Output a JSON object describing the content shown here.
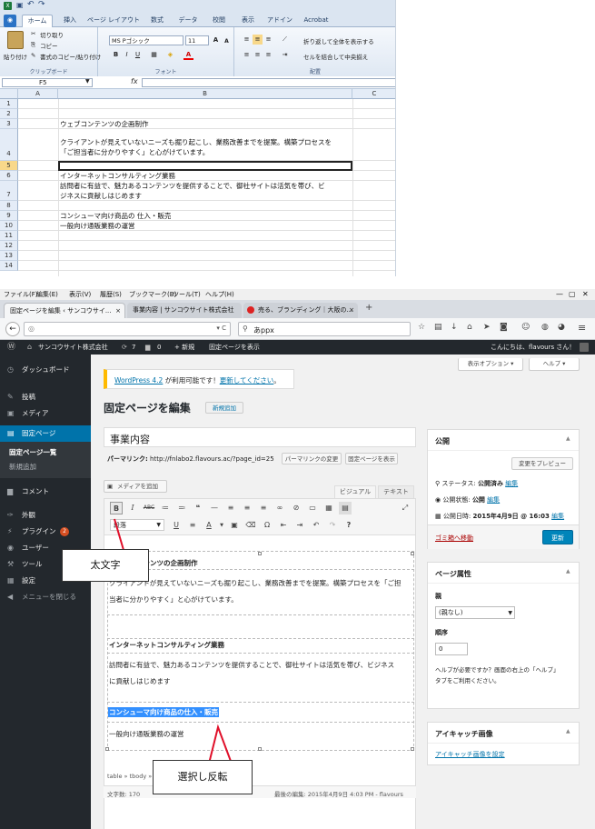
{
  "excel": {
    "tabs": [
      "ホーム",
      "挿入",
      "ページ レイアウト",
      "数式",
      "データ",
      "校閲",
      "表示",
      "アドイン",
      "Acrobat"
    ],
    "clipboard": {
      "paste": "貼り付け",
      "cut": "切り取り",
      "copy": "コピー",
      "format_painter": "書式のコピー/貼り付け",
      "label": "クリップボード"
    },
    "font": {
      "name": "MS Pゴシック",
      "size": "11",
      "label": "フォント"
    },
    "alignment": {
      "wrap": "折り返して全体を表示する",
      "merge": "セルを結合して中央揃え",
      "label": "配置"
    },
    "namebox": "F5",
    "fx": "fx",
    "columns": [
      "A",
      "B",
      "C"
    ],
    "rows": [
      "1",
      "2",
      "3",
      "4",
      "5",
      "6",
      "7",
      "8",
      "9",
      "10",
      "11",
      "12",
      "13",
      "14"
    ],
    "cells": {
      "r3": "ウェブコンテンツの企画制作",
      "r4a": "クライアントが見えていないニーズも掘り起こし、業務改善までを提案。構築プロセスを",
      "r4b": "「ご担当者に分かりやすく」と心がけています。",
      "r6": "インターネットコンサルティング業務",
      "r7a": "訪問者に有益で、魅力あるコンテンツを提供することで、御社サイトは活気を帯び、ビ",
      "r7b": "ジネスに貢献しはじめます",
      "r9": "コンシューマ向け商品の 仕入・販売",
      "r10": "一般向け通販業務の運営"
    }
  },
  "browser": {
    "menu": [
      "ファイル(F)",
      "編集(E)",
      "表示(V)",
      "履歴(S)",
      "ブックマーク(B)",
      "ツール(T)",
      "ヘルプ(H)"
    ],
    "tabs": [
      "固定ページを編集 ‹ サンコウサイ...",
      "事業内容 | サンコウサイト株式会社",
      "売る、ブランディング｜大阪の..."
    ],
    "new_tab": "+",
    "search_value": "あppx"
  },
  "wp": {
    "adminbar": {
      "site": "サンコウサイト株式会社",
      "updates": "7",
      "comments": "0",
      "new": "+ 新規",
      "view": "固定ページを表示",
      "greeting": "こんにちは、flavours さん！"
    },
    "menu": [
      {
        "icon": "ダ",
        "label": "ダッシュボード"
      },
      {
        "icon": "投",
        "label": "投稿"
      },
      {
        "icon": "メ",
        "label": "メディア"
      },
      {
        "icon": "固",
        "label": "固定ページ"
      },
      {
        "icon": "",
        "label": "固定ページ一覧"
      },
      {
        "icon": "",
        "label": "新規追加"
      },
      {
        "icon": "コ",
        "label": "コメント"
      },
      {
        "icon": "外",
        "label": "外観"
      },
      {
        "icon": "プ",
        "label": "プラグイン"
      },
      {
        "icon": "ユ",
        "label": "ユーザー"
      },
      {
        "icon": "ツ",
        "label": "ツール"
      },
      {
        "icon": "設",
        "label": "設定"
      },
      {
        "icon": "◀",
        "label": "メニューを閉じる"
      }
    ],
    "plugin_badge": "2",
    "screen_options": "表示オプション ▾",
    "help": "ヘルプ ▾",
    "notice_link1": "WordPress 4.2",
    "notice_text": " が利用可能です！",
    "notice_link2": "更新してください",
    "notice_end": "。",
    "page_heading": "固定ページを編集",
    "add_new": "新規追加",
    "title_value": "事業内容",
    "permalink_label": "パーマリンク:",
    "permalink_url": "http://fnlabo2.flavours.ac/?page_id=25",
    "permalink_change": "パーマリンクの変更",
    "view_page": "固定ページを表示",
    "add_media": "メディアを追加",
    "tab_visual": "ビジュアル",
    "tab_text": "テキスト",
    "format_select": "段落",
    "content": {
      "h1": "ウェブコンテンツの企画制作",
      "p1a": "クライアントが見えていないニーズも掘り起こし、業務改善までを提案。構築プロセスを「ご担",
      "p1b": "当者に分かりやすく」と心がけています。",
      "h2": "インターネットコンサルティング業務",
      "p2a": "訪問者に有益で、魅力あるコンテンツを提供することで、御社サイトは活気を帯び、ビジネス",
      "p2b": "に貢献しはじめます",
      "h3": "コンシューマ向け商品の仕入・販売",
      "p3": "一般向け通販業務の運営"
    },
    "path": "table » tbody » tr » td » strong",
    "word_count": "文字数: 170",
    "last_edit": "最後の編集: 2015年4月9日 4:03 PM - flavours",
    "publish": {
      "title": "公開",
      "preview": "変更をプレビュー",
      "status_label": "ステータス:",
      "status_value": "公開済み",
      "status_edit": "編集",
      "visibility_label": "公開状態:",
      "visibility_value": "公開",
      "visibility_edit": "編集",
      "date_label": "公開日時:",
      "date_value": "2015年4月9日 @ 16:03",
      "date_edit": "編集",
      "trash": "ゴミ箱へ移動",
      "update": "更新"
    },
    "attributes": {
      "title": "ページ属性",
      "parent_label": "親",
      "parent_value": "(親なし)",
      "order_label": "順序",
      "order_value": "0",
      "help_a": "ヘルプが必要ですか？画面の右上の「ヘルプ」",
      "help_b": "タブをご利用ください。"
    },
    "thumbnail": {
      "title": "アイキャッチ画像",
      "link": "アイキャッチ画像を設定"
    }
  },
  "callouts": {
    "bold": "太文字",
    "select": "選択し反転"
  },
  "colors": {
    "wp_dark": "#23282d",
    "wp_blue": "#0073aa",
    "highlight": "#3390ff",
    "callout_line": "#e0102a"
  }
}
